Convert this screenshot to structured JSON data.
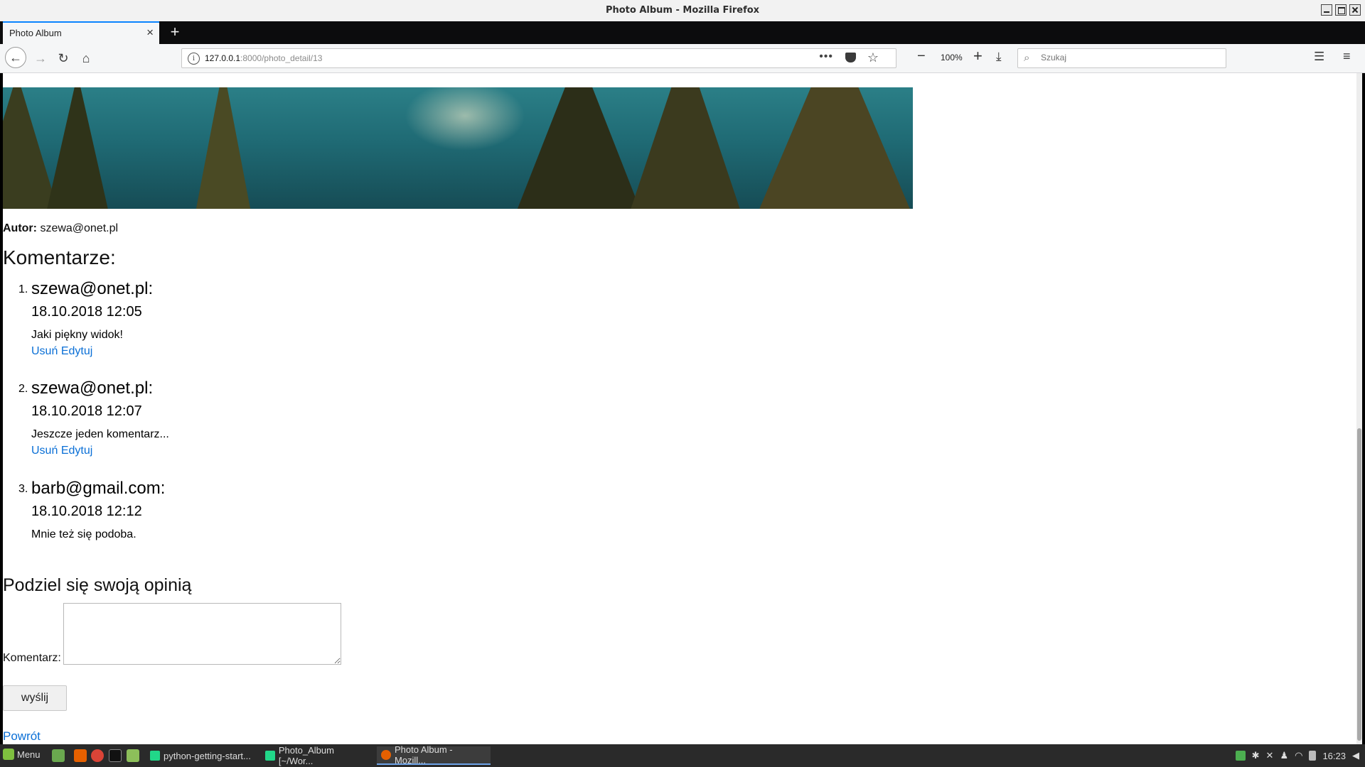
{
  "window": {
    "title": "Photo Album - Mozilla Firefox"
  },
  "tab": {
    "title": "Photo Album"
  },
  "navbar": {
    "url_host": "127.0.0.1",
    "url_path": ":8000/photo_detail/13",
    "zoom": "100%",
    "search_placeholder": "Szukaj"
  },
  "page": {
    "author_label": "Autor:",
    "author_value": "szewa@onet.pl",
    "comments_heading": "Komentarze:",
    "comments": [
      {
        "num": "1.",
        "author": "szewa@onet.pl:",
        "date": "18.10.2018 12:05",
        "text": "Jaki piękny widok!",
        "delete_label": "Usuń",
        "edit_label": "Edytuj"
      },
      {
        "num": "2.",
        "author": "szewa@onet.pl:",
        "date": "18.10.2018 12:07",
        "text": "Jeszcze jeden komentarz...",
        "delete_label": "Usuń",
        "edit_label": "Edytuj"
      },
      {
        "num": "3.",
        "author": "barb@gmail.com:",
        "date": "18.10.2018 12:12",
        "text": "Mnie też się podoba."
      }
    ],
    "form_heading": "Podziel się swoją opinią",
    "form_label": "Komentarz:",
    "submit_label": "wyślij",
    "back_link": "Powrót"
  },
  "taskbar": {
    "menu_label": "Menu",
    "tasks": [
      "python-getting-start...",
      "Photo_Album [~/Wor...",
      "Photo Album - Mozill..."
    ],
    "clock": "16:23"
  },
  "colors": {
    "link": "#0a6fd6",
    "tab_accent": "#0a84ff",
    "taskbar": "#2a2a2a"
  },
  "icons": [
    "back-icon",
    "forward-icon",
    "reload-icon",
    "home-icon",
    "info-icon",
    "page-actions-icon",
    "pocket-icon",
    "bookmark-star-icon",
    "zoom-out-icon",
    "zoom-in-icon",
    "download-icon",
    "search-icon",
    "library-icon",
    "menu-icon"
  ]
}
